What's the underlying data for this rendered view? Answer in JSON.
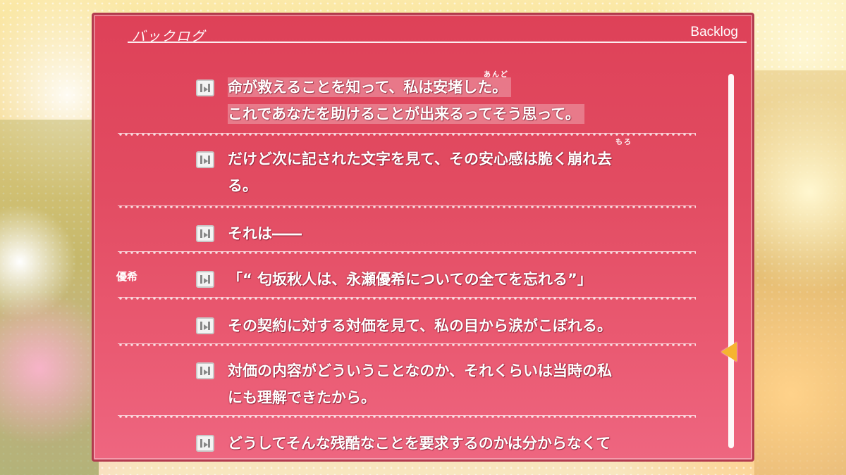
{
  "header": {
    "title_jp": "バックログ",
    "title_en": "Backlog"
  },
  "entries": [
    {
      "speaker": "",
      "lines": [
        "命が救えることを知って、私は安堵した。",
        "これであなたを助けることが出来るってそう思って。"
      ],
      "ruby": "あんど"
    },
    {
      "speaker": "",
      "lines": [
        "だけど次に記された文字を見て、その安心感は脆く崩れ去",
        "る。"
      ],
      "ruby": "もろ"
    },
    {
      "speaker": "",
      "lines": [
        "それは――"
      ]
    },
    {
      "speaker": "優希",
      "lines": [
        "「“ 匂坂秋人は、永瀬優希についての全てを忘れる”」"
      ]
    },
    {
      "speaker": "",
      "lines": [
        "その契約に対する対価を見て、私の目から涙がこぼれる。"
      ]
    },
    {
      "speaker": "",
      "lines": [
        "対価の内容がどういうことなのか、それくらいは当時の私",
        "にも理解できたから。"
      ]
    },
    {
      "speaker": "",
      "lines": [
        "どうしてそんな残酷なことを要求するのかは分からなくて"
      ]
    }
  ],
  "icons": {
    "replay": "voice-replay-icon",
    "scroll": "scroll-thumb-arrow"
  },
  "colors": {
    "panel": "#e24c62",
    "scroll_thumb": "#f6b430"
  }
}
